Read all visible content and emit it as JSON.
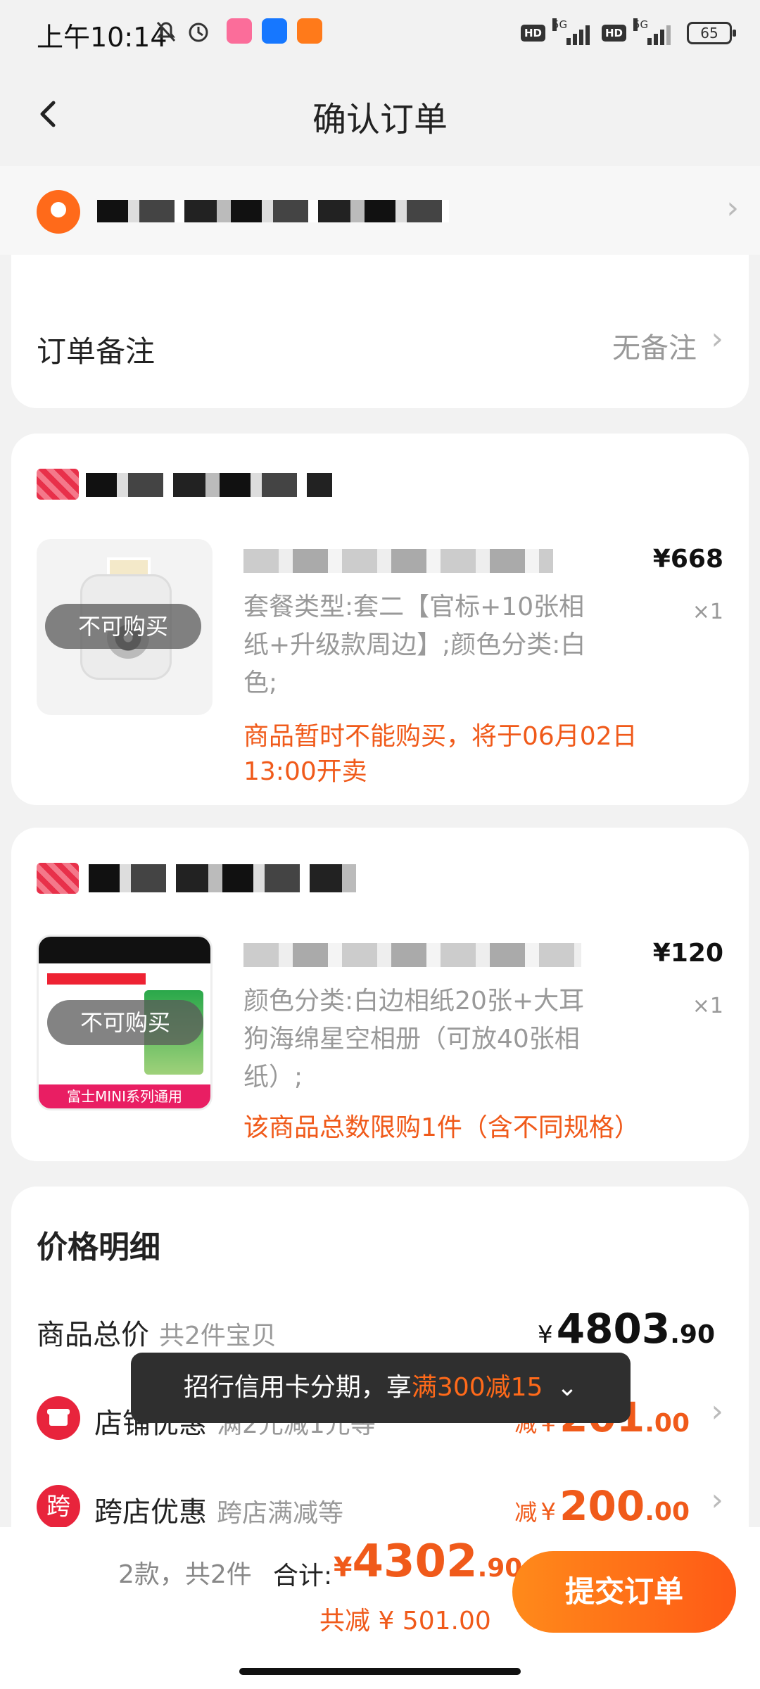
{
  "status_bar": {
    "time": "上午10:14",
    "battery": "65",
    "network1": "5G",
    "network2": "5G",
    "hd1": "HD",
    "hd2": "HD"
  },
  "nav": {
    "title": "确认订单"
  },
  "remark": {
    "label": "订单备注",
    "value": "无备注"
  },
  "items": [
    {
      "unavailable_label": "不可购买",
      "price": "¥668",
      "qty": "×1",
      "spec": "套餐类型:套二【官标+10张相纸+升级款周边】;颜色分类:白色;",
      "warning": "商品暂时不能购买，将于06月02日13:00开卖"
    },
    {
      "unavailable_label": "不可购买",
      "price": "¥120",
      "qty": "×1",
      "spec": "颜色分类:白边相纸20张+大耳狗海绵星空相册（可放40张相纸）;",
      "warning": "该商品总数限购1件（含不同规格）",
      "thumb_banner": "富士MINI系列通用"
    }
  ],
  "price_detail": {
    "title": "价格明细",
    "goods_total": {
      "label": "商品总价",
      "sub": "共2件宝贝",
      "currency": "¥",
      "int": "4803",
      "dec": ".90"
    },
    "shop_discount": {
      "icon_text": "",
      "label": "店铺优惠",
      "sub": "满2元减1元等",
      "prefix": "减",
      "currency": "¥",
      "int": "201",
      "dec": ".00"
    },
    "cross_discount": {
      "icon_text": "跨",
      "label": "跨店优惠",
      "sub": "跨店满减等",
      "prefix": "减",
      "currency": "¥",
      "int": "200",
      "dec": ".00"
    }
  },
  "tooltip": {
    "text_before": "招行信用卡分期，享",
    "highlight": "满300减15",
    "chevron": "⌄"
  },
  "bottom_bar": {
    "count": "2款，共2件",
    "total_label": "合计:",
    "total_currency": "¥",
    "total_int": "4302",
    "total_dec": ".90",
    "saved": "共减 ¥ 501.00",
    "submit": "提交订单"
  },
  "colors": {
    "accent": "#f05a1a",
    "button_start": "#ff8a1a",
    "button_end": "#ff5a16"
  }
}
